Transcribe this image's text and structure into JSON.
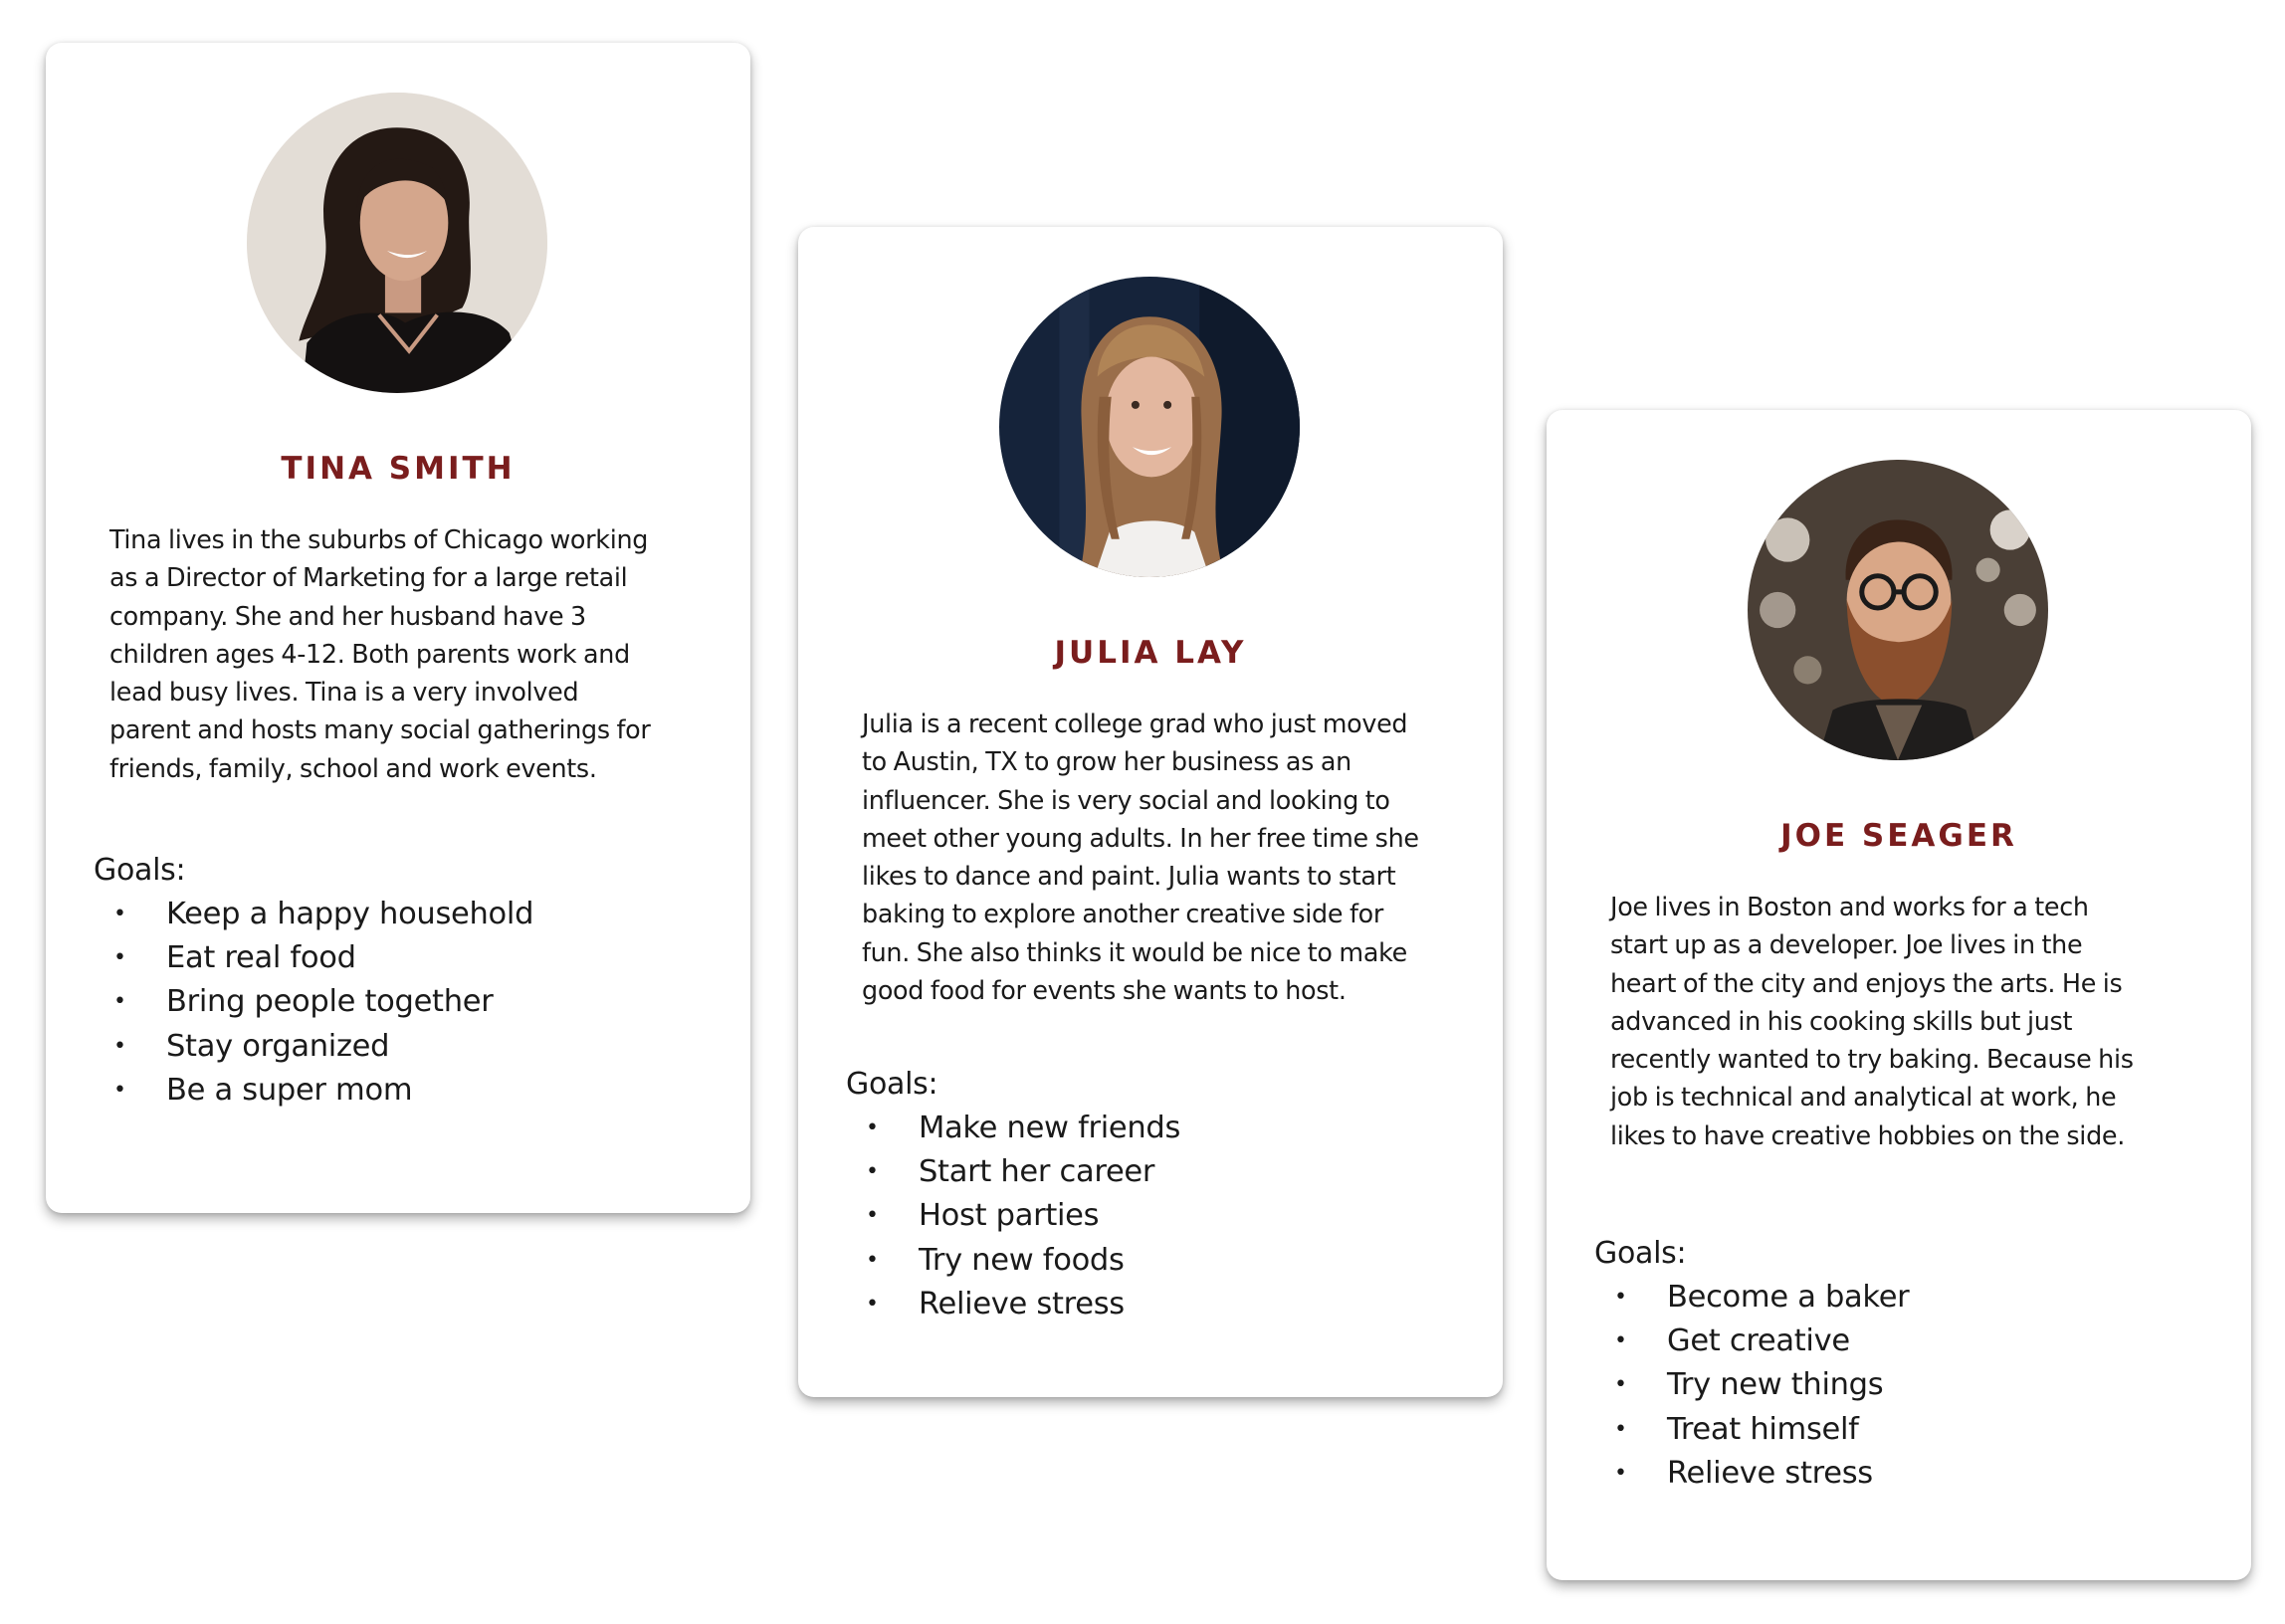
{
  "theme": {
    "name_color": "#7a1d1d",
    "text_color": "#1a1a1a",
    "card_background": "#ffffff"
  },
  "personas": [
    {
      "name": "TINA SMITH",
      "photo_icon": "woman-portrait-photo",
      "bio_lines": [
        "Tina lives in the suburbs of Chicago working",
        "as a Director of Marketing for a large retail",
        "company. She and her husband have 3",
        "children ages 4-12. Both parents work and",
        "lead busy lives. Tina is a very involved",
        "parent and hosts many social gatherings for",
        "friends, family, school and work events."
      ],
      "goals_label": "Goals:",
      "goals": [
        "Keep a happy household",
        "Eat real food",
        "Bring people together",
        "Stay organized",
        "Be a super mom"
      ]
    },
    {
      "name": "JULIA LAY",
      "photo_icon": "young-woman-portrait-photo",
      "bio_lines": [
        "Julia is a recent college grad who just moved",
        "to Austin, TX to grow her business as an",
        "influencer. She is very social and looking to",
        "meet other young adults. In her free time she",
        "likes to dance and paint. Julia wants to start",
        "baking to explore another creative side for",
        "fun. She also thinks it would be nice to make",
        "good food for events she wants to host."
      ],
      "goals_label": "Goals:",
      "goals": [
        "Make new friends",
        "Start her career",
        "Host parties",
        "Try new foods",
        "Relieve stress"
      ]
    },
    {
      "name": "JOE SEAGER",
      "photo_icon": "bearded-man-portrait-photo",
      "bio_lines": [
        "Joe lives in Boston and works for a tech",
        "start up as a developer. Joe lives in the",
        "heart of the city and enjoys the arts. He is",
        "advanced in his cooking skills but just",
        "recently wanted to try baking. Because his",
        "job is technical and analytical at work, he",
        "likes to have creative hobbies on the side."
      ],
      "goals_label": "Goals:",
      "goals": [
        "Become a baker",
        "Get creative",
        "Try new things",
        "Treat himself",
        "Relieve stress"
      ]
    }
  ]
}
